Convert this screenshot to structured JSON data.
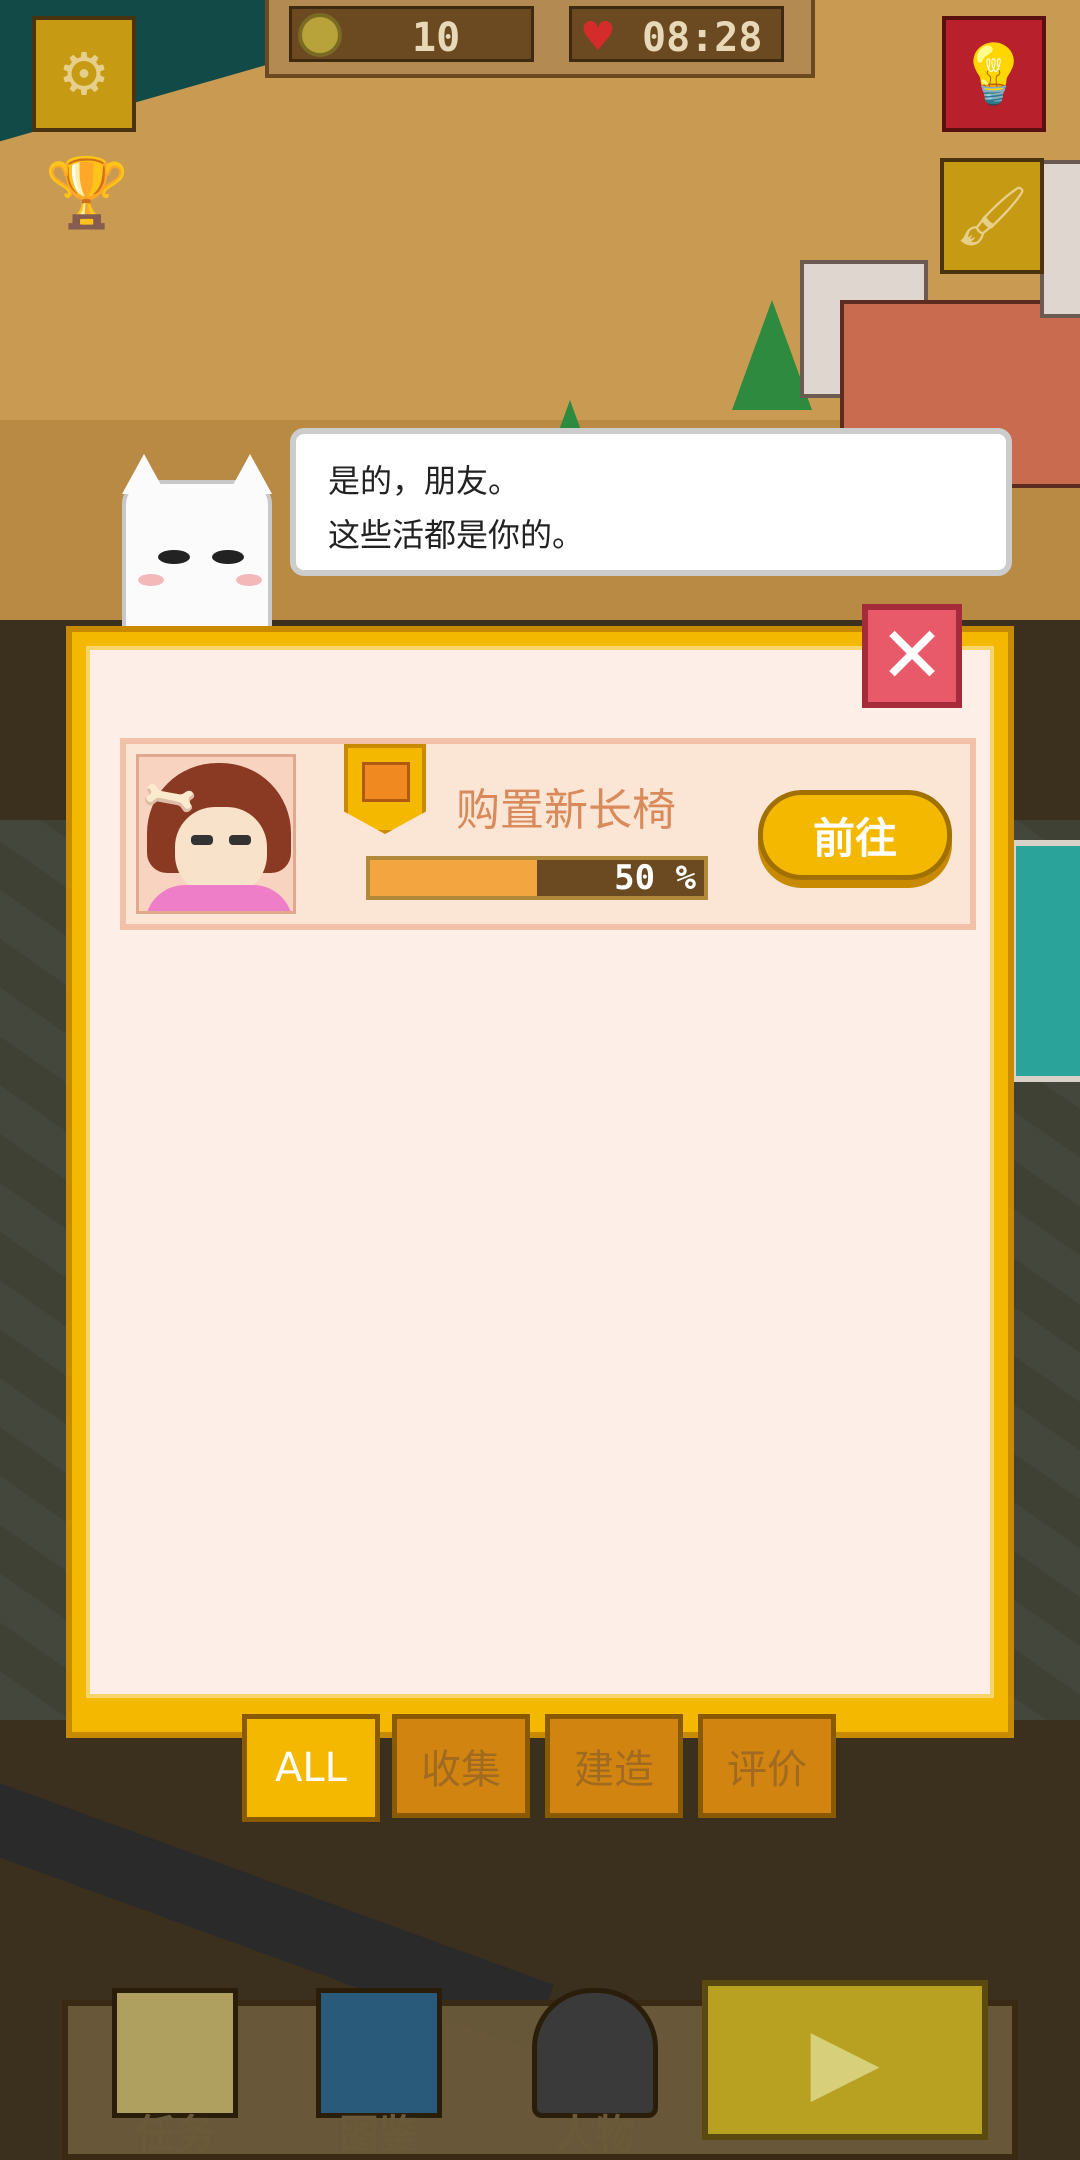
{
  "hud": {
    "coins": "10",
    "timer": "08:28",
    "coin_icon": "coin-icon",
    "heart_icon": "heart-icon"
  },
  "buttons": {
    "settings_icon": "gear-icon",
    "hint_icon": "lightbulb-icon",
    "paint_icon": "paintbrush-icon",
    "trophy_icon": "trophy-icon",
    "close_glyph": "✕"
  },
  "dialog": {
    "line1": "是的，朋友。",
    "line2": "这些活都是你的。"
  },
  "task": {
    "title": "购置新长椅",
    "progress_text": "50 %",
    "progress_value": 0.5,
    "go_label": "前往"
  },
  "tabs": {
    "all": "ALL",
    "collect": "收集",
    "build": "建造",
    "rate": "评价"
  },
  "nav": {
    "tasks": "任务",
    "catalog": "图鉴",
    "people": "人物"
  },
  "colors": {
    "panel": "#f5b800",
    "panel_inner": "#fdeee8",
    "close": "#e85a6a",
    "task_title": "#d98a5a"
  }
}
